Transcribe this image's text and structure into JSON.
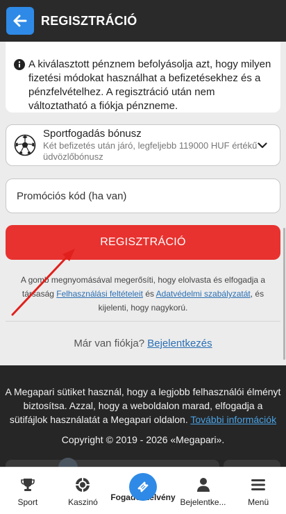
{
  "header": {
    "title": "REGISZTRÁCIÓ",
    "back_icon": "arrow-left-icon"
  },
  "info": {
    "icon": "info-icon",
    "text": "A kiválasztott pénznem befolyásolja azt, hogy milyen fizetési módokat használhat a befizetésekhez és a pénzfelvételhez. A regisztráció után nem változtatható a fiókja pénzneme."
  },
  "bonus": {
    "icon": "soccer-ball-icon",
    "title": "Sportfogadás bónusz",
    "description": "Két befizetés után járó, legfeljebb 119000 HUF értékű üdvözlőbónusz"
  },
  "promo": {
    "placeholder": "Promóciós kód (ha van)"
  },
  "register_button": {
    "label": "REGISZTRÁCIÓ",
    "color": "#e8322f"
  },
  "legal": {
    "before": "A gomb megnyomásával megerősíti, hogy elolvasta és elfogadja a társaság ",
    "terms_link": "Felhasználási feltételeit",
    "and": " és ",
    "privacy_link": "Adatvédelmi szabályzatát",
    "after": ", és kijelenti, hogy nagykorú."
  },
  "login": {
    "question": "Már van fiókja? ",
    "link": "Bejelentkezés"
  },
  "cookie": {
    "text": "A Megapari sütiket használ, hogy a legjobb felhasználói élményt biztosítsa. Azzal, hogy a weboldalon marad, elfogadja a sütifájlok használatát a Megapari oldalon. ",
    "link": "További információk",
    "copyright": "Copyright © 2019 - 2026 «Megapari»."
  },
  "nav": {
    "items": [
      {
        "label": "Sport",
        "icon": "trophy-icon"
      },
      {
        "label": "Kaszinó",
        "icon": "chip-icon"
      },
      {
        "label": "Fogadószelvény",
        "icon": "ticket-icon"
      },
      {
        "label": "Bejelentke...",
        "icon": "user-icon"
      },
      {
        "label": "Menü",
        "icon": "menu-icon"
      }
    ]
  },
  "colors": {
    "accent": "#2e8ae6",
    "header_bg": "#2a2a2a",
    "register": "#e8322f",
    "link": "#2a6fb3",
    "annotation_arrow": "#e0201c"
  }
}
